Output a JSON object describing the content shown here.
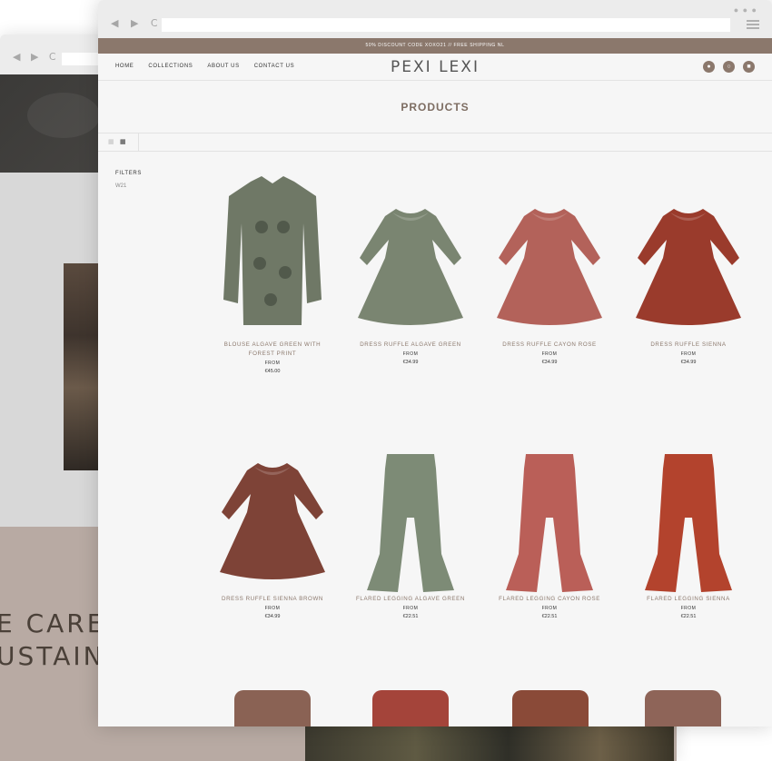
{
  "background_window": {
    "nav_glyphs": "◀ ▶ C",
    "hero_text_line1": "E CARE F",
    "hero_text_line2": "USTAINA"
  },
  "browser": {
    "nav_glyphs": "◀ ▶ C",
    "url": "",
    "dots": "● ● ●"
  },
  "promo_bar": "50% DISCOUNT CODE XOXO21 // FREE SHIPPING NL",
  "header": {
    "menu": [
      "HOME",
      "COLLECTIONS",
      "ABOUT US",
      "CONTACT US"
    ],
    "logo": "PEXI LEXI",
    "icons": [
      "account-icon",
      "search-icon",
      "cart-icon"
    ]
  },
  "page_title": "PRODUCTS",
  "filters": {
    "label": "FILTERS",
    "items": [
      "W21"
    ]
  },
  "products": [
    {
      "name": "BLOUSE ALGAVE GREEN WITH FOREST PRINT",
      "from": "FROM",
      "price": "€45.00",
      "color": "#6f7866"
    },
    {
      "name": "DRESS RUFFLE ALGAVE GREEN",
      "from": "FROM",
      "price": "€34.99",
      "color": "#7a8571"
    },
    {
      "name": "DRESS RUFFLE CAYON ROSE",
      "from": "FROM",
      "price": "€34.99",
      "color": "#b3625a"
    },
    {
      "name": "DRESS RUFFLE SIENNA",
      "from": "FROM",
      "price": "€34.99",
      "color": "#9a3b2c"
    },
    {
      "name": "DRESS RUFFLE SIENNA BROWN",
      "from": "FROM",
      "price": "€34.99",
      "color": "#7e4337"
    },
    {
      "name": "FLARED LEGGING ALGAVE GREEN",
      "from": "FROM",
      "price": "€22.51",
      "color": "#7d8b76"
    },
    {
      "name": "FLARED LEGGING CAYON ROSE",
      "from": "FROM",
      "price": "€22.51",
      "color": "#ba5f58"
    },
    {
      "name": "FLARED LEGGING SIENNA",
      "from": "FROM",
      "price": "€22.51",
      "color": "#b3432d"
    }
  ],
  "partial_row_colors": [
    "#8a6254",
    "#a4443a",
    "#8a4a38",
    "#8e6458"
  ],
  "colors": {
    "accent": "#8b786c",
    "product_name": "#8b786c",
    "title": "#7d6d62"
  }
}
